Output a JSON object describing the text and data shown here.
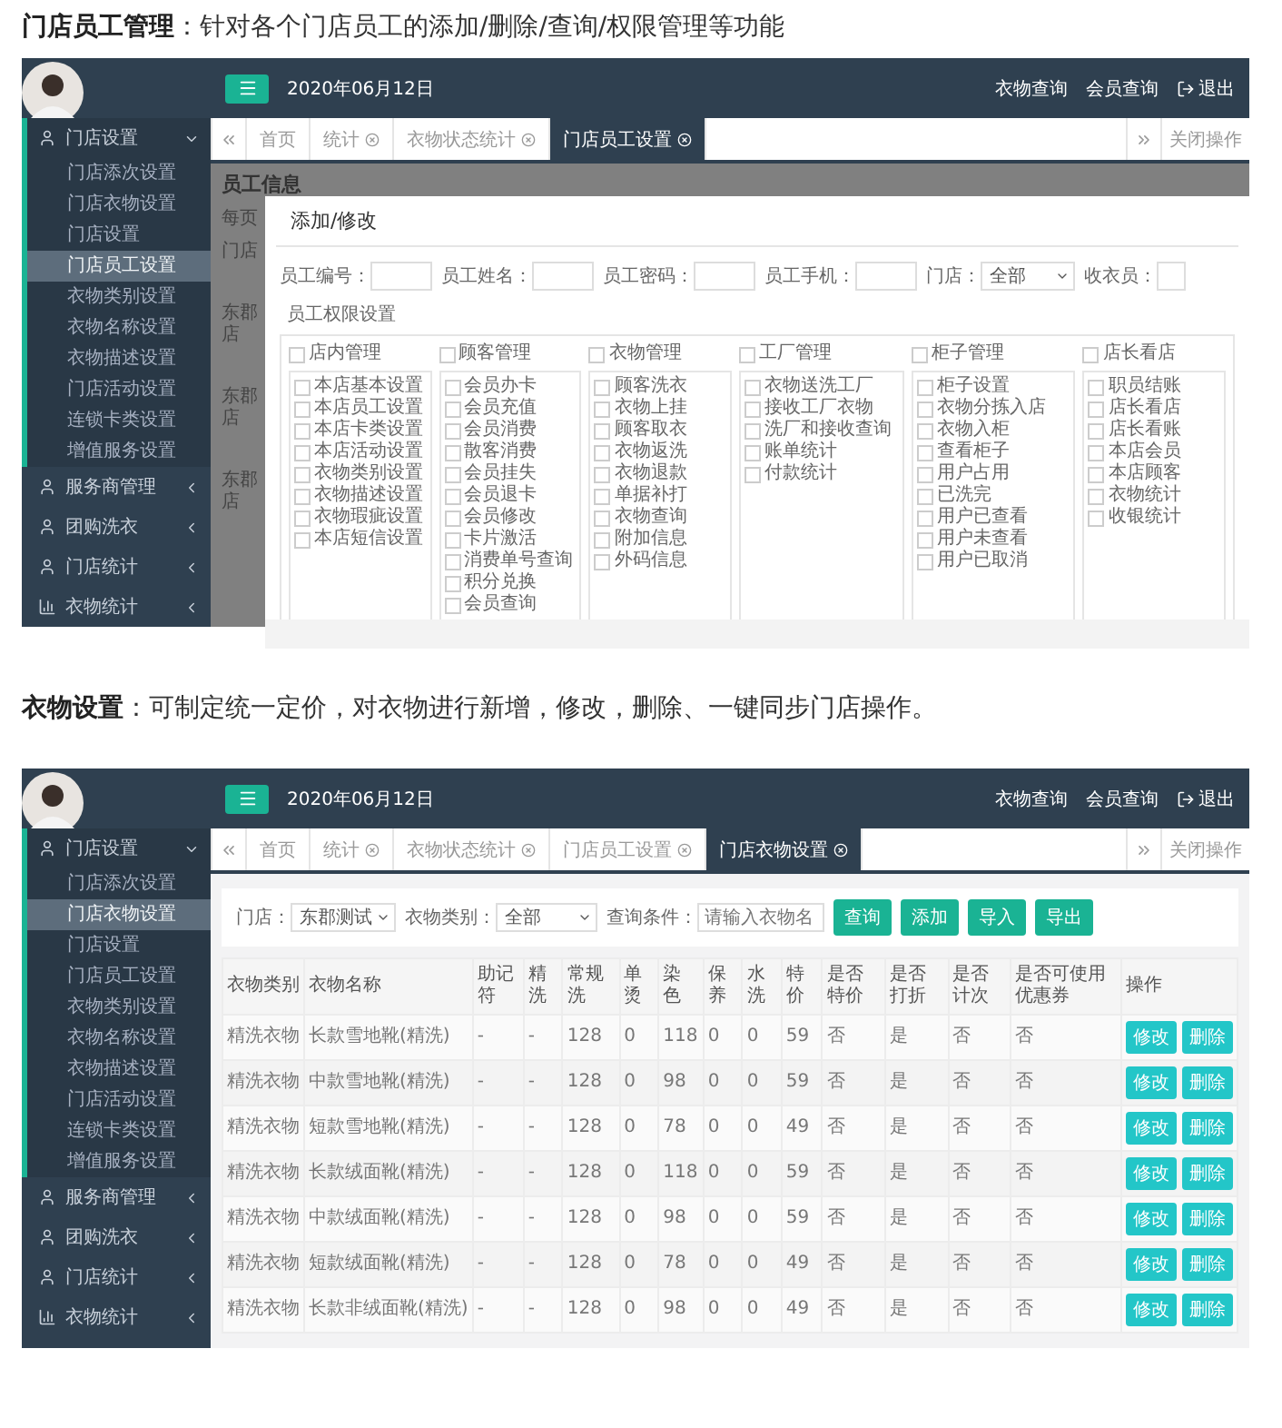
{
  "sections": [
    {
      "heading": "**门店员工管理**：针对各个门店员工的添加/删除/查询/权限管理等功能",
      "screen": {
        "kind": "staff_modal",
        "sidebar": [
          {
            "label": "门店设置",
            "expanded": true,
            "children": [
              {
                "label": "门店添次设置",
                "selected": false
              },
              {
                "label": "门店衣物设置",
                "selected": false
              },
              {
                "label": "门店设置",
                "selected": false
              },
              {
                "label": "门店员工设置",
                "selected": true
              },
              {
                "label": "衣物类别设置",
                "selected": false
              },
              {
                "label": "衣物名称设置",
                "selected": false
              },
              {
                "label": "衣物描述设置",
                "selected": false
              },
              {
                "label": "门店活动设置",
                "selected": false
              },
              {
                "label": "连锁卡类设置",
                "selected": false
              },
              {
                "label": "增值服务设置",
                "selected": false
              }
            ]
          },
          {
            "label": "服务商管理",
            "expanded": false
          },
          {
            "label": "团购洗衣",
            "expanded": false
          },
          {
            "label": "门店统计",
            "expanded": false
          },
          {
            "label": "衣物统计",
            "expanded": false
          }
        ],
        "topbar": {
          "date": "2020年06月12日",
          "links": [
            "衣物查询",
            "会员查询",
            "退出"
          ]
        },
        "tabs": [
          {
            "label": "首页",
            "selected": false
          },
          {
            "label": "统计",
            "selected": false
          },
          {
            "label": "衣物状态统计",
            "selected": false
          },
          {
            "label": "门店员工设置",
            "selected": true
          }
        ],
        "close_menu": "关闭操作",
        "background": {
          "title": "员工信息",
          "per_page": "每页",
          "column": "门店",
          "cells": [
            "东郡店",
            "东郡店",
            "东郡店"
          ]
        },
        "modal": {
          "title": "添加/修改",
          "fields": [
            {
              "label": "员工编号：",
              "kind": "text"
            },
            {
              "label": "员工姓名：",
              "kind": "text"
            },
            {
              "label": "员工密码：",
              "kind": "text"
            },
            {
              "label": "员工手机：",
              "kind": "text"
            },
            {
              "label": "门店：",
              "kind": "select",
              "value": "全部"
            },
            {
              "label": "收衣员：",
              "kind": "text"
            }
          ],
          "section": "员工权限设置",
          "groups": [
            {
              "label": "店内管理",
              "checked": false,
              "items": [
                {
                  "label": "本店基本设置",
                  "checked": false
                },
                {
                  "label": "本店员工设置",
                  "checked": false
                },
                {
                  "label": "本店卡类设置",
                  "checked": false
                },
                {
                  "label": "本店活动设置",
                  "checked": false
                },
                {
                  "label": "衣物类别设置",
                  "checked": false
                },
                {
                  "label": "衣物描述设置",
                  "checked": false
                },
                {
                  "label": "衣物瑕疵设置",
                  "checked": false
                },
                {
                  "label": "本店短信设置",
                  "checked": false
                }
              ]
            },
            {
              "label": "顾客管理",
              "checked": false,
              "items": [
                {
                  "label": "会员办卡",
                  "checked": false
                },
                {
                  "label": "会员充值",
                  "checked": false
                },
                {
                  "label": "会员消费",
                  "checked": false
                },
                {
                  "label": "散客消费",
                  "checked": false
                },
                {
                  "label": "会员挂失",
                  "checked": false
                },
                {
                  "label": "会员退卡",
                  "checked": false
                },
                {
                  "label": "会员修改",
                  "checked": false
                },
                {
                  "label": "卡片激活",
                  "checked": false
                },
                {
                  "label": "消费单号查询",
                  "checked": false
                },
                {
                  "label": "积分兑换",
                  "checked": false
                },
                {
                  "label": "会员查询",
                  "checked": false
                }
              ]
            },
            {
              "label": "衣物管理",
              "checked": false,
              "items": [
                {
                  "label": "顾客洗衣",
                  "checked": false
                },
                {
                  "label": "衣物上挂",
                  "checked": false
                },
                {
                  "label": "顾客取衣",
                  "checked": false
                },
                {
                  "label": "衣物返洗",
                  "checked": false
                },
                {
                  "label": "衣物退款",
                  "checked": false
                },
                {
                  "label": "单据补打",
                  "checked": false
                },
                {
                  "label": "衣物查询",
                  "checked": false
                },
                {
                  "label": "附加信息",
                  "checked": false
                },
                {
                  "label": "外码信息",
                  "checked": false
                }
              ]
            },
            {
              "label": "工厂管理",
              "checked": false,
              "items": [
                {
                  "label": "衣物送洗工厂",
                  "checked": false
                },
                {
                  "label": "接收工厂衣物",
                  "checked": false
                },
                {
                  "label": "洗厂和接收查询",
                  "checked": false
                },
                {
                  "label": "账单统计",
                  "checked": false
                },
                {
                  "label": "付款统计",
                  "checked": false
                }
              ]
            },
            {
              "label": "柜子管理",
              "checked": false,
              "items": [
                {
                  "label": "柜子设置",
                  "checked": false
                },
                {
                  "label": "衣物分拣入店",
                  "checked": false
                },
                {
                  "label": "衣物入柜",
                  "checked": false
                },
                {
                  "label": "查看柜子",
                  "checked": false
                },
                {
                  "label": "用户占用",
                  "checked": false
                },
                {
                  "label": "已洗完",
                  "checked": false
                },
                {
                  "label": "用户已查看",
                  "checked": false
                },
                {
                  "label": "用户未查看",
                  "checked": false
                },
                {
                  "label": "用户已取消",
                  "checked": false
                }
              ]
            },
            {
              "label": "店长看店",
              "checked": false,
              "items": [
                {
                  "label": "职员结账",
                  "checked": false
                },
                {
                  "label": "店长看店",
                  "checked": false
                },
                {
                  "label": "店长看账",
                  "checked": false
                },
                {
                  "label": "本店会员",
                  "checked": false
                },
                {
                  "label": "本店顾客",
                  "checked": false
                },
                {
                  "label": "衣物统计",
                  "checked": false
                },
                {
                  "label": "收银统计",
                  "checked": false
                }
              ]
            }
          ]
        }
      }
    },
    {
      "heading": "**衣物设置**：可制定统一定价，对衣物进行新增，修改，删除、一键同步门店操作。",
      "screen": {
        "kind": "clothing_table",
        "sidebar": [
          {
            "label": "门店设置",
            "expanded": true,
            "children": [
              {
                "label": "门店添次设置",
                "selected": false
              },
              {
                "label": "门店衣物设置",
                "selected": true
              },
              {
                "label": "门店设置",
                "selected": false
              },
              {
                "label": "门店员工设置",
                "selected": false
              },
              {
                "label": "衣物类别设置",
                "selected": false
              },
              {
                "label": "衣物名称设置",
                "selected": false
              },
              {
                "label": "衣物描述设置",
                "selected": false
              },
              {
                "label": "门店活动设置",
                "selected": false
              },
              {
                "label": "连锁卡类设置",
                "selected": false
              },
              {
                "label": "增值服务设置",
                "selected": false
              }
            ]
          },
          {
            "label": "服务商管理",
            "expanded": false
          },
          {
            "label": "团购洗衣",
            "expanded": false
          },
          {
            "label": "门店统计",
            "expanded": false
          },
          {
            "label": "衣物统计",
            "expanded": false
          }
        ],
        "topbar": {
          "date": "2020年06月12日",
          "links": [
            "衣物查询",
            "会员查询",
            "退出"
          ]
        },
        "tabs": [
          {
            "label": "首页",
            "selected": false
          },
          {
            "label": "统计",
            "selected": false
          },
          {
            "label": "衣物状态统计",
            "selected": false
          },
          {
            "label": "门店员工设置",
            "selected": false
          },
          {
            "label": "门店衣物设置",
            "selected": true
          }
        ],
        "close_menu": "关闭操作",
        "filters": [
          {
            "label": "门店：",
            "kind": "select",
            "value": "东郡测试"
          },
          {
            "label": "衣物类别：",
            "kind": "select",
            "value": "全部"
          },
          {
            "label": "查询条件：",
            "kind": "text",
            "placeholder": "请输入衣物名"
          }
        ],
        "buttons": [
          "查询",
          "添加",
          "导入",
          "导出"
        ],
        "table": {
          "columns": [
            "衣物类别",
            "衣物名称",
            "助记符",
            "精洗",
            "常规洗",
            "单烫",
            "染色",
            "保养",
            "水洗",
            "特价",
            "是否特价",
            "是否打折",
            "是否计次",
            "是否可使用优惠券",
            "操作"
          ],
          "rows": [
            {
              "cells": [
                "精洗衣物",
                "长款雪地靴(精洗)",
                "-",
                "-",
                "128",
                "0",
                "118",
                "0",
                "0",
                "59",
                "否",
                "是",
                "否",
                "否"
              ],
              "actions": [
                "修改",
                "删除"
              ]
            },
            {
              "cells": [
                "精洗衣物",
                "中款雪地靴(精洗)",
                "-",
                "-",
                "128",
                "0",
                "98",
                "0",
                "0",
                "59",
                "否",
                "是",
                "否",
                "否"
              ],
              "actions": [
                "修改",
                "删除"
              ]
            },
            {
              "cells": [
                "精洗衣物",
                "短款雪地靴(精洗)",
                "-",
                "-",
                "128",
                "0",
                "78",
                "0",
                "0",
                "49",
                "否",
                "是",
                "否",
                "否"
              ],
              "actions": [
                "修改",
                "删除"
              ]
            },
            {
              "cells": [
                "精洗衣物",
                "长款绒面靴(精洗)",
                "-",
                "-",
                "128",
                "0",
                "118",
                "0",
                "0",
                "59",
                "否",
                "是",
                "否",
                "否"
              ],
              "actions": [
                "修改",
                "删除"
              ]
            },
            {
              "cells": [
                "精洗衣物",
                "中款绒面靴(精洗)",
                "-",
                "-",
                "128",
                "0",
                "98",
                "0",
                "0",
                "59",
                "否",
                "是",
                "否",
                "否"
              ],
              "actions": [
                "修改",
                "删除"
              ]
            },
            {
              "cells": [
                "精洗衣物",
                "短款绒面靴(精洗)",
                "-",
                "-",
                "128",
                "0",
                "78",
                "0",
                "0",
                "49",
                "否",
                "是",
                "否",
                "否"
              ],
              "actions": [
                "修改",
                "删除"
              ]
            },
            {
              "cells": [
                "精洗衣物",
                "长款非绒面靴(精洗)",
                "-",
                "-",
                "128",
                "0",
                "98",
                "0",
                "0",
                "49",
                "否",
                "是",
                "否",
                "否"
              ],
              "actions": [
                "修改",
                "删除"
              ]
            }
          ]
        }
      }
    }
  ]
}
